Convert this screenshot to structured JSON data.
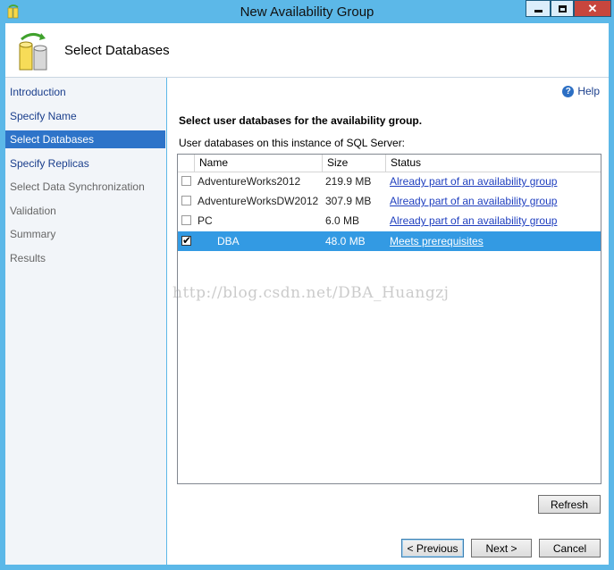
{
  "window": {
    "title": "New Availability Group",
    "minimize_icon": "minimize-icon",
    "maximize_icon": "maximize-icon",
    "close_icon": "close-icon",
    "close_glyph": "✕",
    "accent": "#5cb8e8"
  },
  "header": {
    "title": "Select Databases",
    "icon": "database-wizard-icon"
  },
  "sidebar": {
    "items": [
      {
        "label": "Introduction",
        "state": "link"
      },
      {
        "label": "Specify Name",
        "state": "link"
      },
      {
        "label": "Select Databases",
        "state": "active"
      },
      {
        "label": "Specify Replicas",
        "state": "link"
      },
      {
        "label": "Select Data Synchronization",
        "state": "disabled"
      },
      {
        "label": "Validation",
        "state": "disabled"
      },
      {
        "label": "Summary",
        "state": "disabled"
      },
      {
        "label": "Results",
        "state": "disabled"
      }
    ],
    "active_color": "#2e74c9"
  },
  "main": {
    "help_label": "Help",
    "help_icon": "help-icon",
    "heading": "Select user databases for the availability group.",
    "grid_label": "User databases on this instance of SQL Server:",
    "columns": [
      "Name",
      "Size",
      "Status"
    ],
    "rows": [
      {
        "checked": false,
        "name": "AdventureWorks2012",
        "size": "219.9 MB",
        "status": "Already part of an availability group"
      },
      {
        "checked": false,
        "name": "AdventureWorksDW2012",
        "size": "307.9 MB",
        "status": "Already part of an availability group"
      },
      {
        "checked": false,
        "name": "PC",
        "size": "6.0 MB",
        "status": "Already part of an availability group"
      },
      {
        "checked": true,
        "name": "DBA",
        "size": "48.0 MB",
        "status": "Meets prerequisites"
      }
    ],
    "selected_row_color": "#339ae3",
    "refresh_label": "Refresh"
  },
  "watermark": "http://blog.csdn.net/DBA_Huangzj",
  "footer": {
    "previous_label": "< Previous",
    "next_label": "Next >",
    "cancel_label": "Cancel"
  }
}
